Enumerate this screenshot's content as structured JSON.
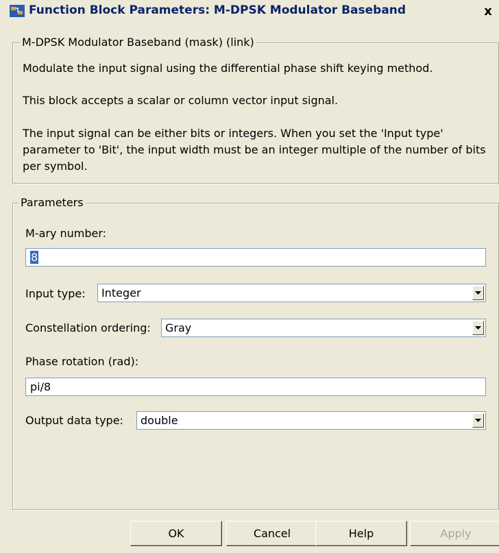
{
  "window": {
    "title": "Function Block Parameters: M-DPSK Modulator Baseband",
    "close_label": "x"
  },
  "description_group": {
    "legend": "M-DPSK Modulator Baseband (mask) (link)",
    "para1": "Modulate the input signal using the differential phase shift keying method.",
    "para2": "This block accepts a scalar or column vector input signal.",
    "para3_line1": "The input signal can be either bits or integers. When you set the 'Input type'",
    "para3_line2": "parameter to 'Bit', the input width must be an integer multiple of the number of bits",
    "para3_line3": "per symbol."
  },
  "parameters_group": {
    "legend": "Parameters",
    "mary_label": "M-ary number:",
    "mary_value": "8",
    "input_type_label": "Input type:",
    "input_type_value": "Integer",
    "constellation_label": "Constellation ordering:",
    "constellation_value": "Gray",
    "phase_label": "Phase rotation (rad):",
    "phase_value": "pi/8",
    "output_label": "Output data type:",
    "output_value": "double"
  },
  "buttons": {
    "ok": "OK",
    "cancel": "Cancel",
    "help": "Help",
    "apply": "Apply"
  },
  "icons": {
    "app": "simulink-block-icon",
    "dropdown": "chevron-down-icon"
  }
}
